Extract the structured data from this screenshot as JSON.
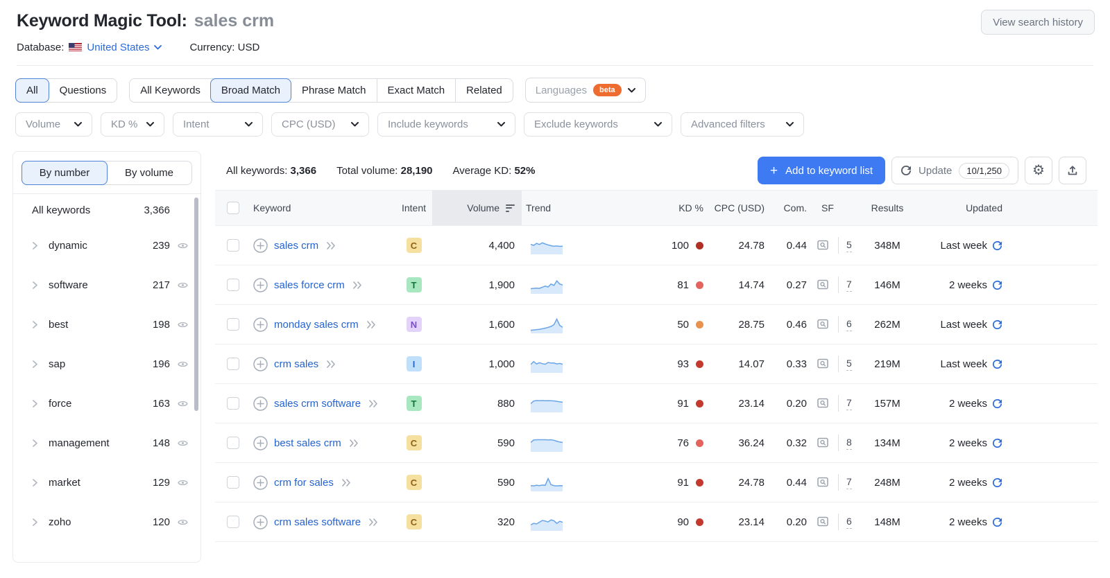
{
  "header": {
    "title": "Keyword Magic Tool:",
    "query": "sales crm",
    "view_search_history": "View search history",
    "database_label": "Database:",
    "database_value": "United States",
    "currency_label": "Currency:",
    "currency_value": "USD"
  },
  "tabs": {
    "group1": [
      {
        "label": "All",
        "selected": true
      },
      {
        "label": "Questions",
        "selected": false
      }
    ],
    "group2": [
      {
        "label": "All Keywords",
        "selected": false
      },
      {
        "label": "Broad Match",
        "selected": true
      },
      {
        "label": "Phrase Match",
        "selected": false
      },
      {
        "label": "Exact Match",
        "selected": false
      },
      {
        "label": "Related",
        "selected": false
      }
    ],
    "languages": {
      "label": "Languages",
      "badge": "beta"
    }
  },
  "filters": [
    "Volume",
    "KD %",
    "Intent",
    "CPC (USD)",
    "Include keywords",
    "Exclude keywords",
    "Advanced filters"
  ],
  "sidebar": {
    "toggle": [
      {
        "label": "By number",
        "selected": true
      },
      {
        "label": "By volume",
        "selected": false
      }
    ],
    "all_row": {
      "label": "All keywords",
      "count": "3,366"
    },
    "groups": [
      {
        "label": "dynamic",
        "count": "239"
      },
      {
        "label": "software",
        "count": "217"
      },
      {
        "label": "best",
        "count": "198"
      },
      {
        "label": "sap",
        "count": "196"
      },
      {
        "label": "force",
        "count": "163"
      },
      {
        "label": "management",
        "count": "148"
      },
      {
        "label": "market",
        "count": "129"
      },
      {
        "label": "zoho",
        "count": "120"
      }
    ]
  },
  "stats": {
    "all_keywords_label": "All keywords:",
    "all_keywords": "3,366",
    "total_volume_label": "Total volume:",
    "total_volume": "28,190",
    "average_kd_label": "Average KD:",
    "average_kd": "52%"
  },
  "actions": {
    "add_label": "Add to keyword list",
    "update_label": "Update",
    "update_quota": "10/1,250"
  },
  "icons": {
    "gear": "⚙",
    "plus": "+"
  },
  "table": {
    "columns": [
      "Keyword",
      "Intent",
      "Volume",
      "Trend",
      "KD %",
      "CPC (USD)",
      "Com.",
      "SF",
      "Results",
      "Updated"
    ],
    "trend_stroke": "#68a4e8",
    "trend_fill": "#d8e9fb",
    "intent_colors": {
      "C": {
        "bg": "#f6e0a0",
        "fg": "#8f6016"
      },
      "T": {
        "bg": "#a9e7c1",
        "fg": "#12753c"
      },
      "N": {
        "bg": "#e3d3fa",
        "fg": "#7e49d8"
      },
      "I": {
        "bg": "#bfdffb",
        "fg": "#2667cf"
      }
    },
    "rows": [
      {
        "keyword": "sales crm",
        "intent": "C",
        "volume": "4,400",
        "trend": [
          60,
          52,
          66,
          58,
          70,
          62,
          55,
          50,
          46,
          48,
          45,
          46
        ],
        "kd": "100",
        "kd_color": "#b02e24",
        "cpc": "24.78",
        "com": "0.44",
        "sf": "5",
        "results": "348M",
        "updated": "Last week"
      },
      {
        "keyword": "sales force crm",
        "intent": "T",
        "volume": "1,900",
        "trend": [
          26,
          28,
          30,
          28,
          36,
          44,
          38,
          58,
          48,
          80,
          58,
          52
        ],
        "kd": "81",
        "kd_color": "#e4635c",
        "cpc": "14.74",
        "com": "0.27",
        "sf": "7",
        "results": "146M",
        "updated": "2 weeks"
      },
      {
        "keyword": "monday sales crm",
        "intent": "N",
        "volume": "1,600",
        "trend": [
          12,
          14,
          16,
          18,
          22,
          26,
          32,
          38,
          50,
          88,
          45,
          32
        ],
        "kd": "50",
        "kd_color": "#e8924e",
        "cpc": "28.75",
        "com": "0.46",
        "sf": "6",
        "results": "262M",
        "updated": "Last week"
      },
      {
        "keyword": "crm sales",
        "intent": "I",
        "volume": "1,000",
        "trend": [
          48,
          68,
          52,
          60,
          54,
          50,
          62,
          58,
          58,
          52,
          55,
          50
        ],
        "kd": "93",
        "kd_color": "#c4392e",
        "cpc": "14.07",
        "com": "0.33",
        "sf": "5",
        "results": "219M",
        "updated": "Last week"
      },
      {
        "keyword": "sales crm software",
        "intent": "T",
        "volume": "880",
        "trend": [
          50,
          68,
          72,
          71,
          72,
          70,
          71,
          70,
          69,
          66,
          63,
          60
        ],
        "kd": "91",
        "kd_color": "#c4392e",
        "cpc": "23.14",
        "com": "0.20",
        "sf": "7",
        "results": "157M",
        "updated": "2 weeks"
      },
      {
        "keyword": "best sales crm",
        "intent": "C",
        "volume": "590",
        "trend": [
          55,
          72,
          74,
          74,
          74,
          74,
          73,
          74,
          70,
          64,
          58,
          55
        ],
        "kd": "76",
        "kd_color": "#e4635c",
        "cpc": "36.24",
        "com": "0.32",
        "sf": "8",
        "results": "134M",
        "updated": "2 weeks"
      },
      {
        "keyword": "crm for sales",
        "intent": "C",
        "volume": "590",
        "trend": [
          30,
          28,
          33,
          30,
          34,
          32,
          78,
          36,
          30,
          28,
          30,
          29
        ],
        "kd": "91",
        "kd_color": "#c4392e",
        "cpc": "24.78",
        "com": "0.44",
        "sf": "7",
        "results": "248M",
        "updated": "2 weeks"
      },
      {
        "keyword": "crm sales software",
        "intent": "C",
        "volume": "320",
        "trend": [
          32,
          42,
          38,
          50,
          62,
          58,
          52,
          66,
          60,
          42,
          56,
          50
        ],
        "kd": "90",
        "kd_color": "#c4392e",
        "cpc": "23.14",
        "com": "0.20",
        "sf": "6",
        "results": "148M",
        "updated": "2 weeks"
      }
    ]
  }
}
